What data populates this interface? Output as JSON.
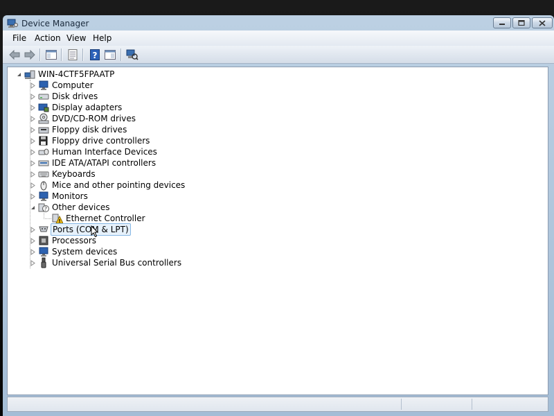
{
  "window": {
    "title": "Device Manager"
  },
  "menu": {
    "items": [
      "File",
      "Action",
      "View",
      "Help"
    ]
  },
  "toolbar": {
    "buttons": [
      {
        "name": "back-arrow-icon"
      },
      {
        "name": "forward-arrow-icon"
      },
      {
        "name": "show-hide-console-tree-icon"
      },
      {
        "name": "properties-icon"
      },
      {
        "name": "help-icon"
      },
      {
        "name": "show-action-pane-icon"
      },
      {
        "name": "scan-hardware-changes-icon"
      }
    ]
  },
  "tree": {
    "root": {
      "label": "WIN-4CTF5FPAATP",
      "expanded": true,
      "icon": "computer-icon"
    },
    "categories": [
      {
        "label": "Computer",
        "icon": "computer-monitor-icon"
      },
      {
        "label": "Disk drives",
        "icon": "disk-drive-icon"
      },
      {
        "label": "Display adapters",
        "icon": "display-adapter-icon"
      },
      {
        "label": "DVD/CD-ROM drives",
        "icon": "dvd-drive-icon"
      },
      {
        "label": "Floppy disk drives",
        "icon": "floppy-drive-icon"
      },
      {
        "label": "Floppy drive controllers",
        "icon": "floppy-controller-icon"
      },
      {
        "label": "Human Interface Devices",
        "icon": "hid-icon"
      },
      {
        "label": "IDE ATA/ATAPI controllers",
        "icon": "ide-controller-icon"
      },
      {
        "label": "Keyboards",
        "icon": "keyboard-icon"
      },
      {
        "label": "Mice and other pointing devices",
        "icon": "mouse-icon"
      },
      {
        "label": "Monitors",
        "icon": "monitor-icon"
      },
      {
        "label": "Other devices",
        "icon": "unknown-device-icon",
        "expanded": true,
        "children": [
          {
            "label": "Ethernet Controller",
            "icon": "warning-device-icon"
          }
        ]
      },
      {
        "label": "Ports (COM & LPT)",
        "icon": "port-icon",
        "hovered": true
      },
      {
        "label": "Processors",
        "icon": "processor-icon"
      },
      {
        "label": "System devices",
        "icon": "system-device-icon"
      },
      {
        "label": "Universal Serial Bus controllers",
        "icon": "usb-icon"
      }
    ]
  },
  "colors": {
    "window_frame": "#b0c6dc",
    "hover_fill": "#e6f1fb",
    "hover_border": "#86b7e4",
    "warning": "#f2c01a"
  }
}
